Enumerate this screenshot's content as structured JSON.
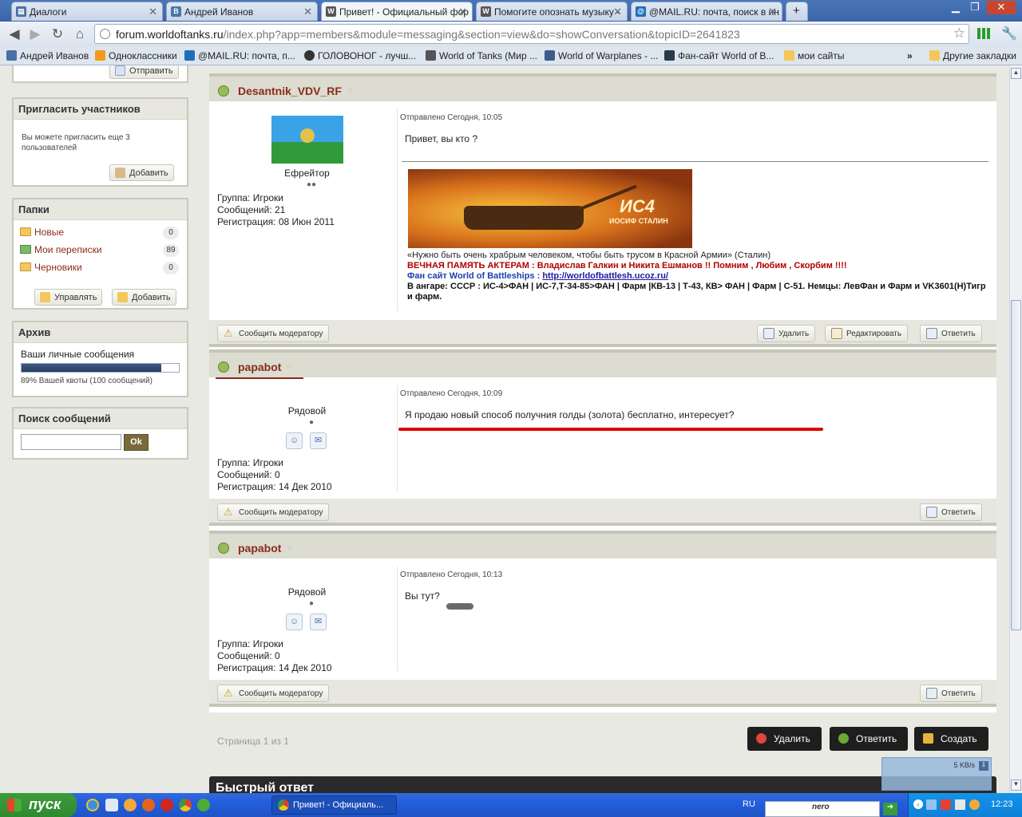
{
  "tabs": [
    {
      "label": "Диалоги",
      "fav_color": "#4a6fa5"
    },
    {
      "label": "Андрей Иванов",
      "fav_color": "#4a76a8"
    },
    {
      "label": "Привет! - Официальный фор",
      "fav_color": "#555555",
      "active": true
    },
    {
      "label": "Помогите опознать музыку -",
      "fav_color": "#555555"
    },
    {
      "label": "@MAIL.RU: почта, поиск в ин",
      "fav_color": "#1e6fb8"
    }
  ],
  "address": {
    "host": "forum.worldoftanks.ru",
    "path": "/index.php?app=members&module=messaging&section=view&do=showConversation&topicID=2641823"
  },
  "bookmarks": [
    "Андрей Иванов",
    "Одноклассники",
    "@MAIL.RU: почта, п...",
    "ГОЛОВОНОГ - лучш...",
    "World of Tanks (Мир ...",
    "World of Warplanes - ...",
    "Фан-сайт World of B...",
    "мои сайты",
    "Другие закладки"
  ],
  "sidebar": {
    "send_label": "Отправить",
    "invite": {
      "title": "Пригласить участников",
      "text": "Вы можете пригласить еще 3 пользователей",
      "add_label": "Добавить"
    },
    "folders": {
      "title": "Папки",
      "items": [
        {
          "label": "Новые",
          "count": "0"
        },
        {
          "label": "Мои переписки",
          "count": "89"
        },
        {
          "label": "Черновики",
          "count": "0"
        }
      ],
      "manage_label": "Управлять",
      "add_label": "Добавить"
    },
    "archive": {
      "title": "Архив",
      "label": "Ваши личные сообщения",
      "quota_fraction": 0.89,
      "quota_text": "89% Вашей квоты (100 сообщений)"
    },
    "search": {
      "title": "Поиск сообщений",
      "button": "Ok",
      "value": ""
    }
  },
  "posts": [
    {
      "author": "Desantnik_VDV_RF",
      "rank": "Ефрейтор",
      "pips": "●●",
      "group": "Группа: Игроки",
      "count": "Сообщений: 21",
      "reg": "Регистрация: 08 Июн 2011",
      "date": "Отправлено Сегодня, 10:05",
      "text": "Привет, вы кто ?",
      "banner_text": "ИС4",
      "banner_sub": "ИОСИФ СТАЛИН",
      "sig_quote": "«Нужно быть очень храбрым человеком, чтобы быть трусом в Красной Армии» (Сталин)",
      "sig_memory": "ВЕЧНАЯ ПАМЯТЬ АКТЕРАМ : Владислав Галкин и Никита Ешманов !! Помним , Любим , Скорбим !!!!",
      "sig_fan_label": "Фан сайт World of Battleships : ",
      "sig_fan_link": "http://worldofbattlesh.ucoz.ru/",
      "sig_hangar": "В ангаре: СССР : ИС-4>ФАН | ИС-7,Т-34-85>ФАН | Фарм |КВ-13 | Т-43, КВ> ФАН | Фарм | С-51. Немцы: ЛевФан и Фарм и VK3601(H)Тигр и фарм.",
      "buttons": [
        "Сообщить модератору",
        "Удалить",
        "Редактировать",
        "Ответить"
      ]
    },
    {
      "author": "papabot",
      "rank": "Рядовой",
      "pips": "●",
      "group": "Группа: Игроки",
      "count": "Сообщений: 0",
      "reg": "Регистрация: 14 Дек 2010",
      "date": "Отправлено Сегодня, 10:09",
      "text": "Я продаю новый способ получния голды (золота) бесплатно, интересует?",
      "buttons": [
        "Сообщить модератору",
        "Ответить"
      ]
    },
    {
      "author": "papabot",
      "rank": "Рядовой",
      "pips": "●",
      "group": "Группа: Игроки",
      "count": "Сообщений: 0",
      "reg": "Регистрация: 14 Дек 2010",
      "date": "Отправлено Сегодня, 10:13",
      "text": "Вы тут?",
      "buttons": [
        "Сообщить модератору",
        "Ответить"
      ]
    }
  ],
  "pagination": "Страница 1 из 1",
  "actions": [
    "Удалить",
    "Ответить",
    "Создать"
  ],
  "quick_reply": "Быстрый ответ",
  "netspeed": "5 KB/s",
  "taskbar": {
    "start": "пуск",
    "window": "Привет! - Официаль...",
    "lang": "RU",
    "time": "12:23",
    "nero": "nero"
  }
}
